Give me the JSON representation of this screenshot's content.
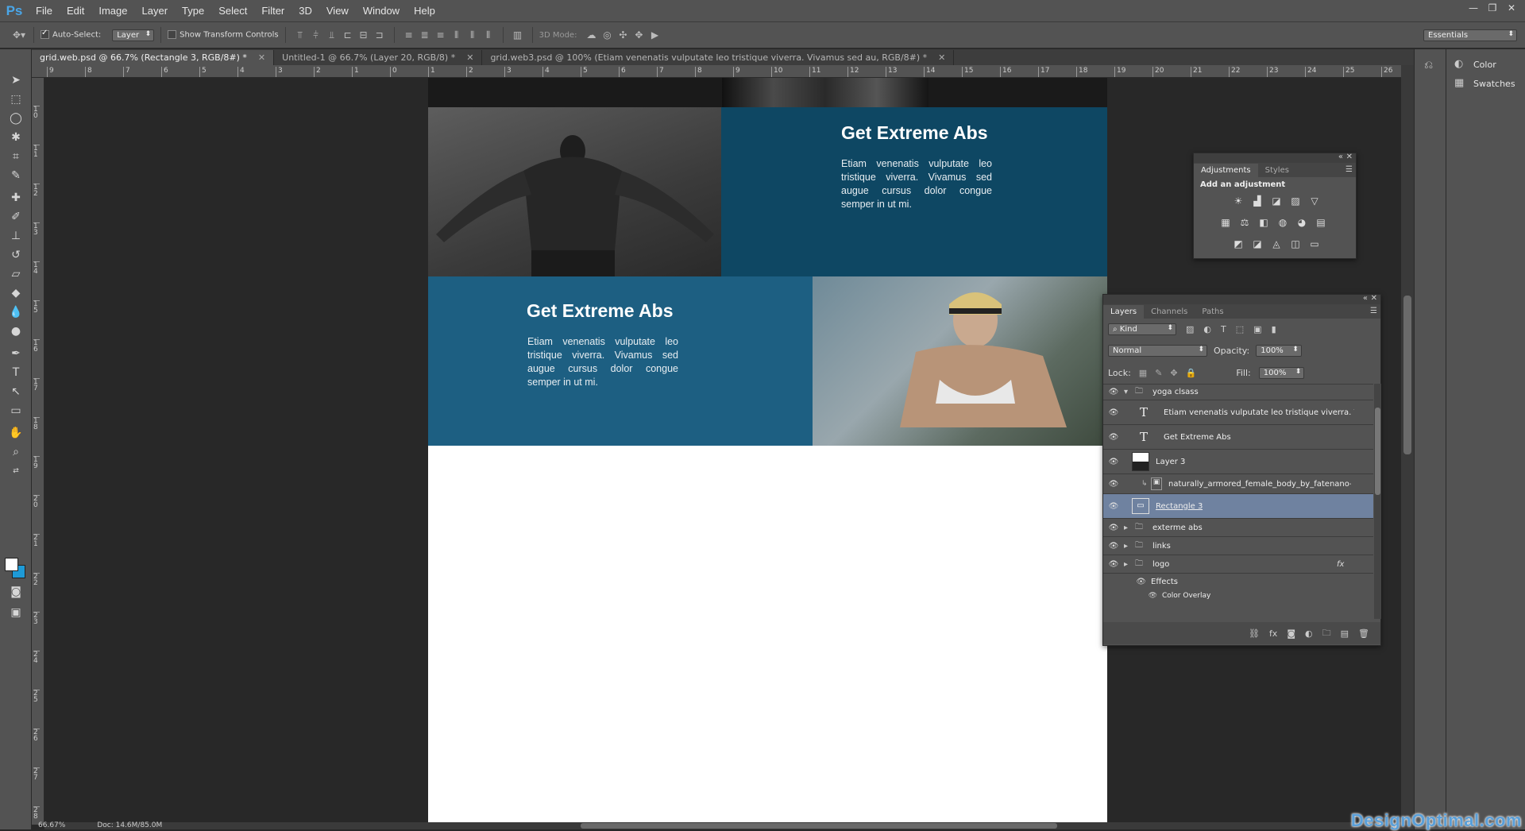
{
  "app": {
    "logo": "Ps"
  },
  "menu": [
    "File",
    "Edit",
    "Image",
    "Layer",
    "Type",
    "Select",
    "Filter",
    "3D",
    "View",
    "Window",
    "Help"
  ],
  "window_controls": [
    "—",
    "❐",
    "✕"
  ],
  "options_bar": {
    "auto_select_label": "Auto-Select:",
    "auto_select_value": "Layer",
    "show_transform_label": "Show Transform Controls",
    "mode_3d_label": "3D Mode:",
    "workspace": "Essentials"
  },
  "tabs": [
    {
      "label": "grid.web.psd @ 66.7% (Rectangle 3, RGB/8#) *",
      "active": true
    },
    {
      "label": "Untitled-1 @ 66.7% (Layer 20, RGB/8) *",
      "active": false
    },
    {
      "label": "grid.web3.psd @ 100% (Etiam venenatis vulputate leo tristique viverra. Vivamus sed au, RGB/8#) *",
      "active": false
    }
  ],
  "ruler": {
    "h_ticks": [
      "9",
      "8",
      "7",
      "6",
      "5",
      "4",
      "3",
      "2",
      "1",
      "0",
      "1",
      "2",
      "3",
      "4",
      "5",
      "6",
      "7",
      "8",
      "9",
      "10",
      "11",
      "12",
      "13",
      "14",
      "15",
      "16",
      "17",
      "18",
      "19",
      "20",
      "21",
      "22",
      "23",
      "24",
      "25",
      "26"
    ],
    "v_ticks": [
      "1 0",
      "1 1",
      "1 2",
      "1 3",
      "1 4",
      "1 5",
      "1 6",
      "1 7",
      "1 8",
      "1 9",
      "2 0",
      "2 1",
      "2 2",
      "2 3",
      "2 4",
      "2 5",
      "2 6",
      "2 7",
      "2 8"
    ]
  },
  "document": {
    "block1": {
      "title": "Get Extreme Abs",
      "body": "Etiam venenatis vulputate leo tristique viverra. Vivamus sed augue cursus dolor congue semper in ut mi."
    },
    "block2": {
      "title": "Get Extreme Abs",
      "body": "Etiam venenatis vulputate leo tristique viverra. Vivamus sed augue cursus dolor congue semper in ut mi."
    }
  },
  "status": {
    "zoom": "66.67%",
    "doc": "Doc: 14.6M/85.0M"
  },
  "watermark": "DesignOptimal.com",
  "right_dock": {
    "color": "Color",
    "swatches": "Swatches"
  },
  "adjustments_panel": {
    "tabs": [
      "Adjustments",
      "Styles"
    ],
    "add_label": "Add an adjustment",
    "icons_row1": [
      "☀",
      "▟",
      "◪",
      "▨",
      "▽"
    ],
    "icons_row2": [
      "▦",
      "⚖",
      "◧",
      "◍",
      "◕",
      "▤"
    ],
    "icons_row3": [
      "◩",
      "◪",
      "◬",
      "◫",
      "▭"
    ]
  },
  "layers_panel": {
    "tabs": [
      "Layers",
      "Channels",
      "Paths"
    ],
    "filter": "Kind",
    "blend_mode": "Normal",
    "opacity_label": "Opacity:",
    "opacity": "100%",
    "lock_label": "Lock:",
    "fill_label": "Fill:",
    "fill": "100%",
    "layers": [
      {
        "name": "yoga clsass",
        "kind": "group-open"
      },
      {
        "name": "Etiam venenatis vulputate leo tristique viverra. V...",
        "kind": "text"
      },
      {
        "name": "Get Extreme Abs",
        "kind": "text"
      },
      {
        "name": "Layer 3",
        "kind": "pixel"
      },
      {
        "name": "naturally_armored_female_body_by_fatenano-d...",
        "kind": "smart"
      },
      {
        "name": "Rectangle 3",
        "kind": "shape",
        "selected": true
      },
      {
        "name": "exterme abs",
        "kind": "group"
      },
      {
        "name": "links",
        "kind": "group"
      },
      {
        "name": "logo",
        "kind": "group",
        "fx": "fx"
      },
      {
        "name": "Effects",
        "kind": "effects"
      },
      {
        "name": "Color Overlay",
        "kind": "effect-item"
      }
    ]
  },
  "colors": {
    "accent_dark_blue": "#0e4763",
    "accent_blue": "#1d5f82",
    "selection": "#6f82a0"
  }
}
